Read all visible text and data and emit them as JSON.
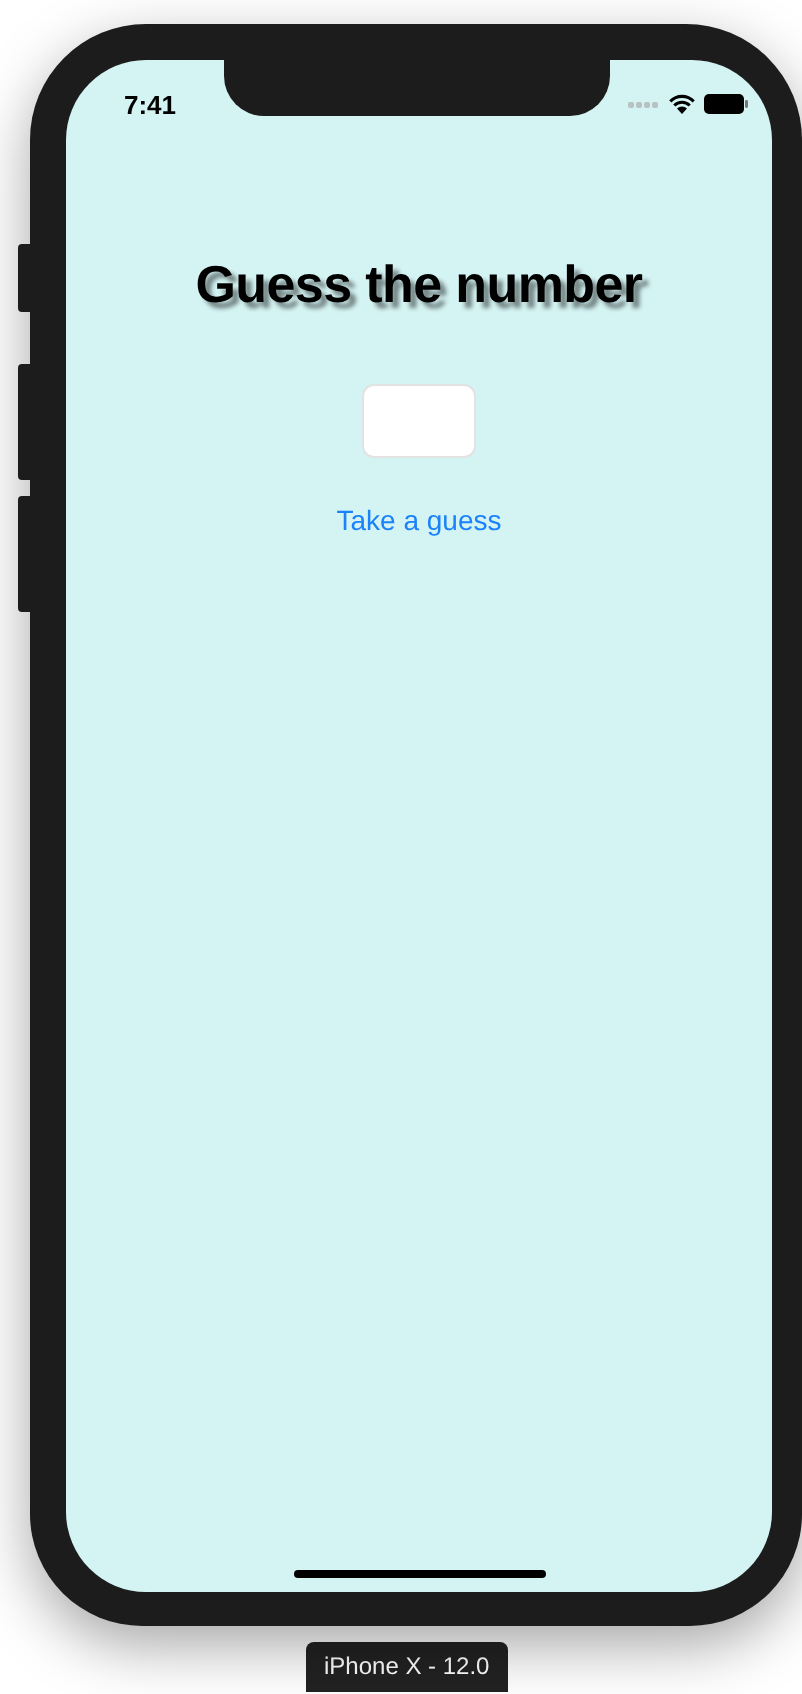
{
  "status_bar": {
    "time": "7:41"
  },
  "title": "Guess the number",
  "guess_button": {
    "label": "Take a guess"
  },
  "device_label": "iPhone X - 12.0"
}
